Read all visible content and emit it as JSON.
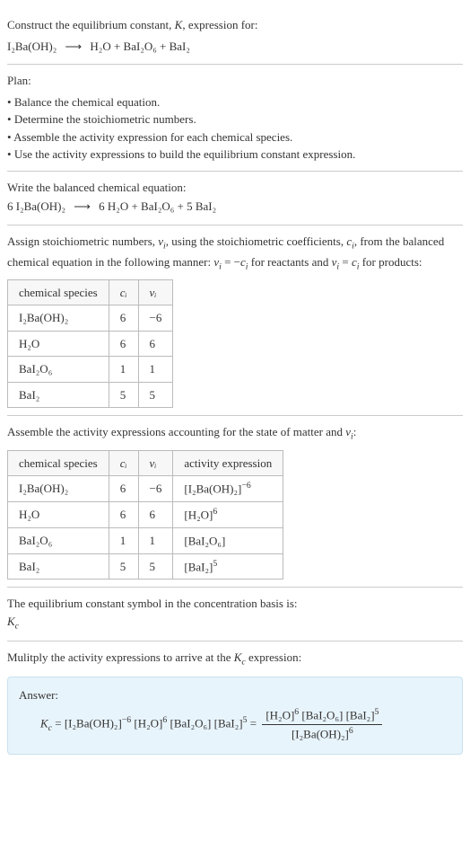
{
  "intro": {
    "line1": "Construct the equilibrium constant, ",
    "K": "K",
    "line1b": ", expression for:",
    "eq_lhs": "I₂Ba(OH)₂",
    "arrow": "⟶",
    "eq_rhs": "H₂O + BaI₂O₆ + BaI₂"
  },
  "plan": {
    "title": "Plan:",
    "items": [
      "Balance the chemical equation.",
      "Determine the stoichiometric numbers.",
      "Assemble the activity expression for each chemical species.",
      "Use the activity expressions to build the equilibrium constant expression."
    ]
  },
  "balanced": {
    "title": "Write the balanced chemical equation:",
    "lhs": "6 I₂Ba(OH)₂",
    "arrow": "⟶",
    "rhs": "6 H₂O + BaI₂O₆ + 5 BaI₂"
  },
  "assign": {
    "text_a": "Assign stoichiometric numbers, ",
    "nu": "ν",
    "sub_i": "i",
    "text_b": ", using the stoichiometric coefficients, ",
    "c": "c",
    "text_c": ", from the balanced chemical equation in the following manner: ",
    "rel1_l": "ν",
    "rel1_eq": " = −",
    "rel1_r": "c",
    "text_d": " for reactants and ",
    "rel2_eq": " = ",
    "text_e": " for products:"
  },
  "table1": {
    "h1": "chemical species",
    "h2": "cᵢ",
    "h3": "νᵢ",
    "rows": [
      {
        "sp": "I₂Ba(OH)₂",
        "c": "6",
        "v": "−6"
      },
      {
        "sp": "H₂O",
        "c": "6",
        "v": "6"
      },
      {
        "sp": "BaI₂O₆",
        "c": "1",
        "v": "1"
      },
      {
        "sp": "BaI₂",
        "c": "5",
        "v": "5"
      }
    ]
  },
  "assemble": {
    "text_a": "Assemble the activity expressions accounting for the state of matter and ",
    "nu": "ν",
    "sub_i": "i",
    "text_b": ":"
  },
  "table2": {
    "h1": "chemical species",
    "h2": "cᵢ",
    "h3": "νᵢ",
    "h4": "activity expression",
    "rows": [
      {
        "sp": "I₂Ba(OH)₂",
        "c": "6",
        "v": "−6",
        "base": "[I₂Ba(OH)₂]",
        "exp": "−6"
      },
      {
        "sp": "H₂O",
        "c": "6",
        "v": "6",
        "base": "[H₂O]",
        "exp": "6"
      },
      {
        "sp": "BaI₂O₆",
        "c": "1",
        "v": "1",
        "base": "[BaI₂O₆]",
        "exp": ""
      },
      {
        "sp": "BaI₂",
        "c": "5",
        "v": "5",
        "base": "[BaI₂]",
        "exp": "5"
      }
    ]
  },
  "kc_symbol": {
    "text": "The equilibrium constant symbol in the concentration basis is:",
    "sym": "K",
    "sub": "c"
  },
  "multiply": {
    "text_a": "Mulitply the activity expressions to arrive at the ",
    "K": "K",
    "sub": "c",
    "text_b": " expression:"
  },
  "answer": {
    "label": "Answer:",
    "Kc_K": "K",
    "Kc_c": "c",
    "eq": " = ",
    "t1_base": "[I₂Ba(OH)₂]",
    "t1_exp": "−6",
    "t2_base": "[H₂O]",
    "t2_exp": "6",
    "t3_base": "[BaI₂O₆]",
    "t3_exp": "",
    "t4_base": "[BaI₂]",
    "t4_exp": "5",
    "eq2": " = ",
    "num_a_base": "[H₂O]",
    "num_a_exp": "6",
    "num_b_base": "[BaI₂O₆]",
    "num_b_exp": "",
    "num_c_base": "[BaI₂]",
    "num_c_exp": "5",
    "den_base": "[I₂Ba(OH)₂]",
    "den_exp": "6"
  },
  "chart_data": {
    "type": "table",
    "tables": [
      {
        "columns": [
          "chemical species",
          "c_i",
          "nu_i"
        ],
        "rows": [
          [
            "I2Ba(OH)2",
            6,
            -6
          ],
          [
            "H2O",
            6,
            6
          ],
          [
            "BaI2O6",
            1,
            1
          ],
          [
            "BaI2",
            5,
            5
          ]
        ]
      },
      {
        "columns": [
          "chemical species",
          "c_i",
          "nu_i",
          "activity expression"
        ],
        "rows": [
          [
            "I2Ba(OH)2",
            6,
            -6,
            "[I2Ba(OH)2]^-6"
          ],
          [
            "H2O",
            6,
            6,
            "[H2O]^6"
          ],
          [
            "BaI2O6",
            1,
            1,
            "[BaI2O6]"
          ],
          [
            "BaI2",
            5,
            5,
            "[BaI2]^5"
          ]
        ]
      }
    ]
  }
}
